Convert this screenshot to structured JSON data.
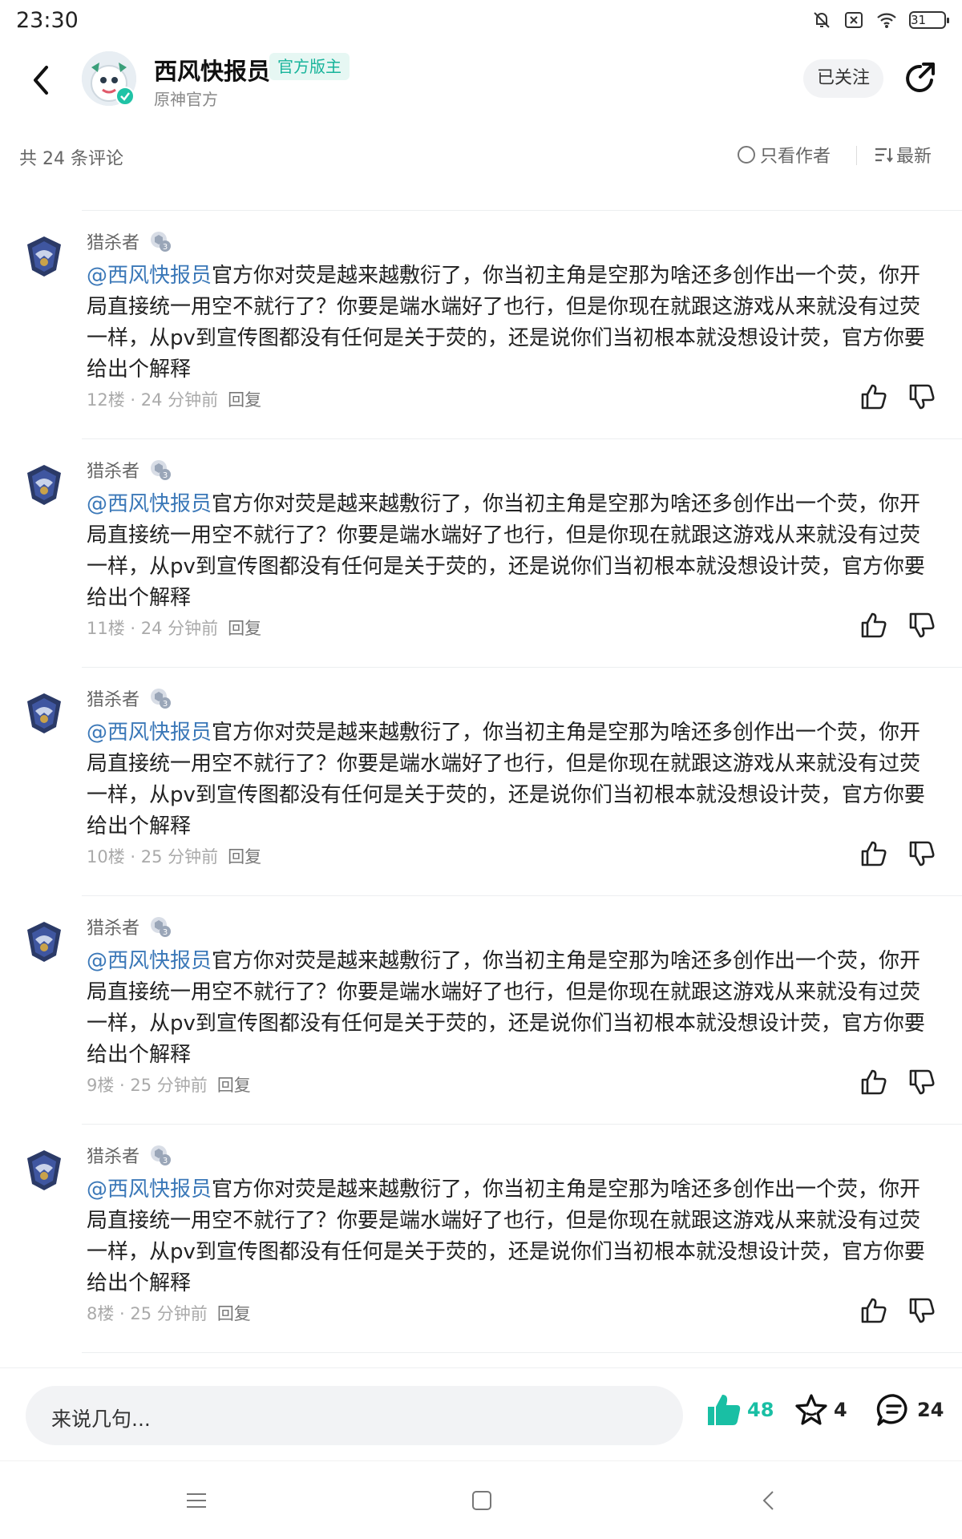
{
  "status_bar": {
    "time": "23:30",
    "battery": "31"
  },
  "header": {
    "back_icon": "back-arrow-icon",
    "name": "西风快报员",
    "badge": "官方版主",
    "subtitle": "原神官方",
    "follow_label": "已关注",
    "share_icon": "share-icon"
  },
  "filter": {
    "count_label": "共 24 条评论",
    "author_only_label": "只看作者",
    "sort_label": "最新"
  },
  "comments": [
    {
      "user": "猎杀者",
      "mention": "@西风快报员",
      "text": "官方你对荧是越来越敷衍了，你当初主角是空那为啥还多创作出一个荧，你开局直接统一用空不就行了？你要是端水端好了也行，但是你现在就跟这游戏从来就没有过荧一样，从pv到宣传图都没有任何是关于荧的，还是说你们当初根本就没想设计荧，官方你要给出个解释",
      "floor": "12楼",
      "time": "24 分钟前",
      "reply": "回复"
    },
    {
      "user": "猎杀者",
      "mention": "@西风快报员",
      "text": "官方你对荧是越来越敷衍了，你当初主角是空那为啥还多创作出一个荧，你开局直接统一用空不就行了？你要是端水端好了也行，但是你现在就跟这游戏从来就没有过荧一样，从pv到宣传图都没有任何是关于荧的，还是说你们当初根本就没想设计荧，官方你要给出个解释",
      "floor": "11楼",
      "time": "24 分钟前",
      "reply": "回复"
    },
    {
      "user": "猎杀者",
      "mention": "@西风快报员",
      "text": "官方你对荧是越来越敷衍了，你当初主角是空那为啥还多创作出一个荧，你开局直接统一用空不就行了？你要是端水端好了也行，但是你现在就跟这游戏从来就没有过荧一样，从pv到宣传图都没有任何是关于荧的，还是说你们当初根本就没想设计荧，官方你要给出个解释",
      "floor": "10楼",
      "time": "25 分钟前",
      "reply": "回复"
    },
    {
      "user": "猎杀者",
      "mention": "@西风快报员",
      "text": "官方你对荧是越来越敷衍了，你当初主角是空那为啥还多创作出一个荧，你开局直接统一用空不就行了？你要是端水端好了也行，但是你现在就跟这游戏从来就没有过荧一样，从pv到宣传图都没有任何是关于荧的，还是说你们当初根本就没想设计荧，官方你要给出个解释",
      "floor": "9楼",
      "time": "25 分钟前",
      "reply": "回复"
    },
    {
      "user": "猎杀者",
      "mention": "@西风快报员",
      "text": "官方你对荧是越来越敷衍了，你当初主角是空那为啥还多创作出一个荧，你开局直接统一用空不就行了？你要是端水端好了也行，但是你现在就跟这游戏从来就没有过荧一样，从pv到宣传图都没有任何是关于荧的，还是说你们当初根本就没想设计荧，官方你要给出个解释",
      "floor": "8楼",
      "time": "25 分钟前",
      "reply": "回复"
    }
  ],
  "bottom": {
    "input_placeholder": "来说几句...",
    "likes": "48",
    "favorites": "4",
    "comments": "24"
  },
  "colors": {
    "accent": "#19bfa4",
    "mention": "#3b78b8"
  }
}
